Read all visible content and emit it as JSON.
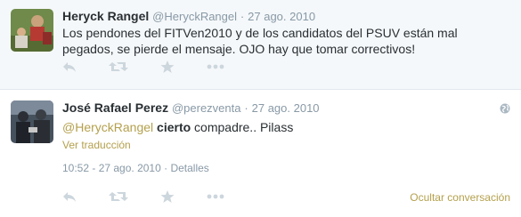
{
  "tweets": [
    {
      "fullname": "Heryck Rangel",
      "handle": "@HeryckRangel",
      "separator": "·",
      "time": "27 ago. 2010",
      "text": "Los pendones del FITVen2010 y de los candidatos del PSUV están mal pegados, se pierde el mensaje. OJO hay que tomar correctivos!"
    },
    {
      "fullname": "José Rafael Perez",
      "handle": "@perezventa",
      "separator": "·",
      "time": "27 ago. 2010",
      "mention": "@HeryckRangel",
      "bold_word": "cierto",
      "text_rest": " compadre.. Pilass",
      "translate_label": "Ver traducción",
      "detail_time": "10:52 - 27 ago. 2010",
      "detail_sep": "·",
      "details_label": "Detalles",
      "collapse_label": "Ocultar conversación"
    }
  ],
  "icons": [
    "reply-icon",
    "retweet-icon",
    "favorite-icon",
    "more-icon",
    "globe-icon"
  ],
  "colors": {
    "accent": "#b4a04d",
    "muted": "#8899a6",
    "text": "#292f33",
    "bg_focus": "#f5f8fa"
  }
}
